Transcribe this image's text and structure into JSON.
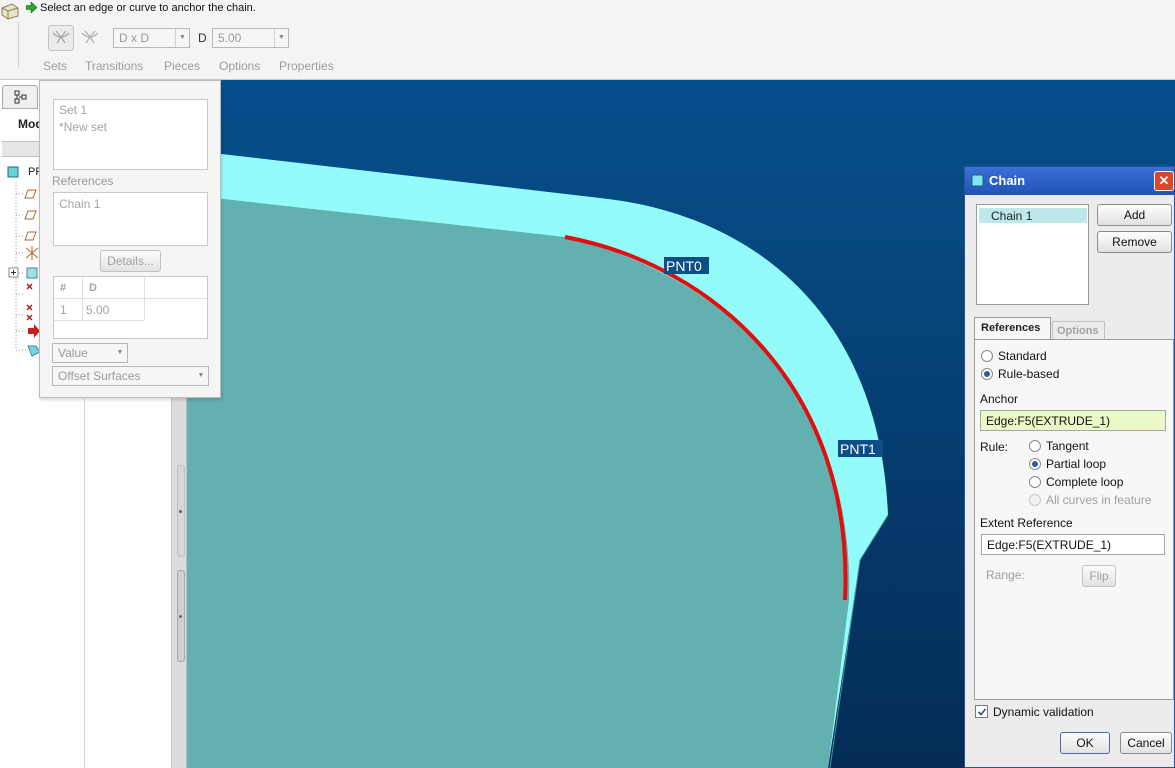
{
  "dashboard": {
    "prompt": "Select an edge or curve to anchor the chain.",
    "dim_scheme": "D x D",
    "d_label": "D",
    "d_value": "5.00",
    "tabs": [
      "Sets",
      "Transitions",
      "Pieces",
      "Options",
      "Properties"
    ]
  },
  "left_panel": {
    "model_label": "Mod",
    "tree_root": "PR"
  },
  "sets_panel": {
    "sets": [
      "Set 1",
      "*New set"
    ],
    "references_label": "References",
    "reference_item": "Chain 1",
    "details_button": "Details...",
    "table_headers": [
      "#",
      "D"
    ],
    "table_rows": [
      [
        "1",
        "5.00"
      ]
    ],
    "value_combo": "Value",
    "offset_combo": "Offset Surfaces"
  },
  "viewport": {
    "point_labels": [
      "PNT0",
      "PNT1"
    ],
    "colors": {
      "background_top": "#06508c",
      "background_bottom": "#042c56",
      "part_face": "#62b1b0",
      "part_rim": "#94fbfb",
      "selected_edge": "#e01010"
    }
  },
  "chain_dialog": {
    "title": "Chain",
    "list_items": [
      "Chain 1"
    ],
    "add_button": "Add",
    "remove_button": "Remove",
    "tabs": [
      "References",
      "Options"
    ],
    "mode_options": [
      {
        "label": "Standard",
        "selected": false
      },
      {
        "label": "Rule-based",
        "selected": true
      }
    ],
    "anchor_label": "Anchor",
    "anchor_value": "Edge:F5(EXTRUDE_1)",
    "rule_label": "Rule:",
    "rule_options": [
      {
        "label": "Tangent",
        "selected": false,
        "enabled": true
      },
      {
        "label": "Partial loop",
        "selected": true,
        "enabled": true
      },
      {
        "label": "Complete loop",
        "selected": false,
        "enabled": true
      },
      {
        "label": "All curves in feature",
        "selected": false,
        "enabled": false
      }
    ],
    "extent_label": "Extent Reference",
    "extent_value": "Edge:F5(EXTRUDE_1)",
    "range_label": "Range:",
    "flip_button": "Flip",
    "dynamic_validation": {
      "label": "Dynamic validation",
      "checked": true
    },
    "ok_button": "OK",
    "cancel_button": "Cancel"
  }
}
